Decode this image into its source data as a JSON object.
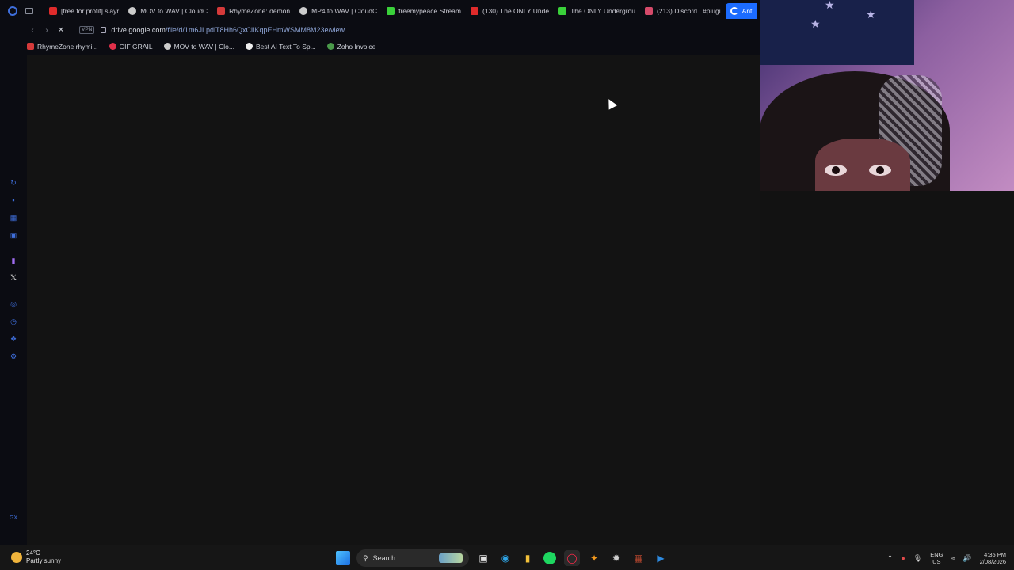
{
  "browser": {
    "tabs": [
      {
        "title": "[free for profit] slayr",
        "color": "#e02b2b"
      },
      {
        "title": "MOV to WAV | CloudC",
        "color": "#cccccc"
      },
      {
        "title": "RhymeZone: demon",
        "color": "#d63a3a"
      },
      {
        "title": "MP4 to WAV | CloudC",
        "color": "#cccccc"
      },
      {
        "title": "freemypeace Stream",
        "color": "#3ad13a"
      },
      {
        "title": "(130) The ONLY Unde",
        "color": "#e02b2b"
      },
      {
        "title": "The ONLY Undergrou",
        "color": "#3ad13a"
      },
      {
        "title": "(213) Discord | #plugi",
        "color": "#d64a6a"
      },
      {
        "title": "Ant",
        "color": "#ffffff",
        "active": true
      }
    ],
    "address": {
      "host": "drive.google.com",
      "path": "/file/d/1m6JLpdlT8Hh6QxCiIKqpEHmWSMM8M23e/view",
      "vpn_label": "VPN"
    },
    "bookmarks": [
      {
        "label": "RhymeZone rhymi...",
        "color": "#d63a3a"
      },
      {
        "label": "GIF GRAIL",
        "color": "#e0304a"
      },
      {
        "label": "MOV to WAV | Clo...",
        "color": "#cccccc"
      },
      {
        "label": "Best AI Text To Sp...",
        "color": "#eeeeee"
      },
      {
        "label": "Zoho Invoice",
        "color": "#4a9a4a"
      }
    ],
    "sidebar_bottom_label": "GX"
  },
  "taskbar": {
    "weather_temp": "24°C",
    "weather_desc": "Partly sunny",
    "search_label": "Search",
    "lang_top": "ENG",
    "lang_bottom": "US",
    "time": "4:35 PM",
    "date": "2/08/2026"
  }
}
